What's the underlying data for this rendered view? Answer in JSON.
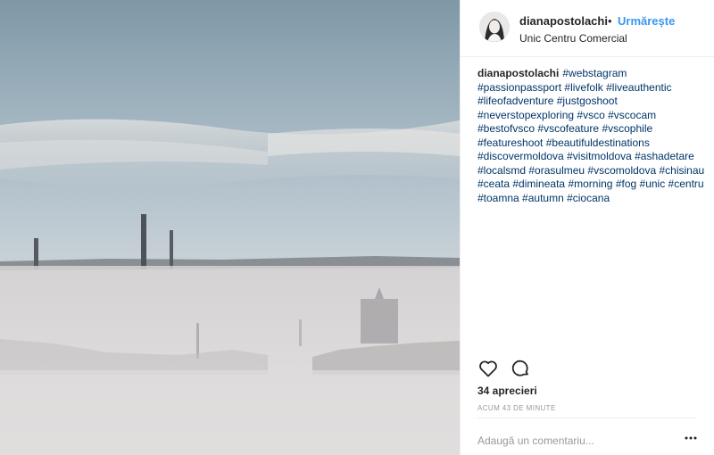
{
  "post": {
    "photo_alt_icon": "foggy-city-photo",
    "user": {
      "username": "dianapostolachi",
      "separator": "•",
      "follow_label": "Urmărește",
      "location": "Unic Centru Comercial"
    },
    "caption": {
      "author": "dianapostolachi",
      "hashtags": [
        "#webstagram",
        "#passionpassport",
        "#livefolk",
        "#liveauthentic",
        "#lifeofadventure",
        "#justgoshoot",
        "#neverstopexploring",
        "#vsco",
        "#vscocam",
        "#bestofvsco",
        "#vscofeature",
        "#vscophile",
        "#featureshoot",
        "#beautifuldestinations",
        "#discovermoldova",
        "#visitmoldova",
        "#ashadetare",
        "#localsmd",
        "#orasulmeu",
        "#vscomoldova",
        "#chisinau",
        "#ceata",
        "#dimineata",
        "#morning",
        "#fog",
        "#unic",
        "#centru",
        "#toamna",
        "#autumn",
        "#ciocana"
      ]
    },
    "actions": {
      "like_icon": "heart-icon",
      "comment_icon": "comment-bubble-icon"
    },
    "likes_text": "34 aprecieri",
    "timestamp": "ACUM 43 DE MINUTE",
    "comment_placeholder": "Adaugă un comentariu...",
    "more_icon": "more-options-icon"
  },
  "colors": {
    "link": "#003569",
    "follow": "#3897f0",
    "muted": "#999999"
  }
}
